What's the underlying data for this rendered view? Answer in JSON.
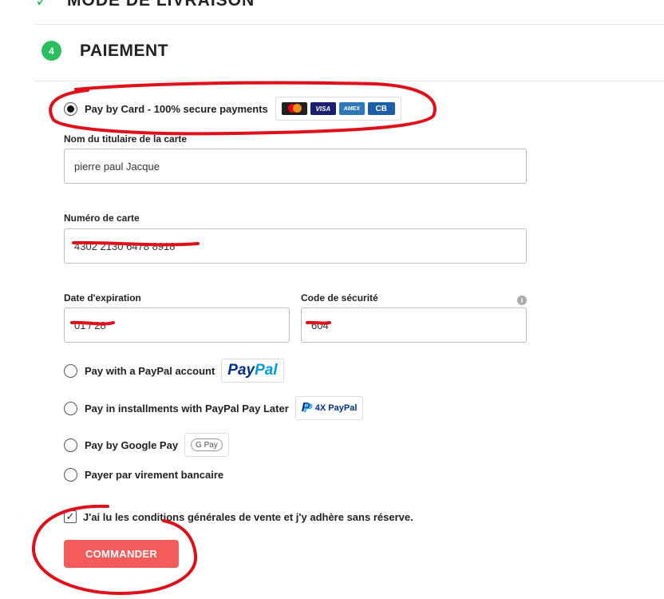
{
  "previous_step": {
    "title": "MODE DE LIVRAISON"
  },
  "payment": {
    "step_number": "4",
    "title": "PAIEMENT",
    "card_option": {
      "label": "Pay by Card - 100% secure payments",
      "selected": true,
      "logos": [
        "mastercard",
        "VISA",
        "AMEX",
        "CB"
      ]
    },
    "cardholder": {
      "label": "Nom du titulaire de la carte",
      "value": "pierre paul Jacque"
    },
    "card_number": {
      "label": "Numéro de carte",
      "value": "4302 2130 6478 8918"
    },
    "expiry": {
      "label": "Date d'expiration",
      "value": "01 / 28"
    },
    "cvc": {
      "label": "Code de sécurité",
      "value": "604",
      "info_icon": "info-icon"
    },
    "paypal_option": {
      "label": "Pay with a PayPal account",
      "badge_pay": "Pay",
      "badge_pal": "Pal"
    },
    "paylater_option": {
      "label": "Pay in installments with PayPal Pay Later",
      "badge_text": "4X PayPal"
    },
    "googlepay_option": {
      "label": "Pay by Google Pay",
      "badge_text": "G Pay"
    },
    "transfer_option": {
      "label": "Payer par virement bancaire"
    },
    "terms": {
      "label": "J'ai lu les conditions générales de vente et j'y adhère sans réserve.",
      "checked": true
    },
    "submit_label": "COMMANDER"
  },
  "colors": {
    "step_green": "#2dbe60",
    "cta_red": "#f45b5b",
    "annotation_red": "#e0101a"
  }
}
